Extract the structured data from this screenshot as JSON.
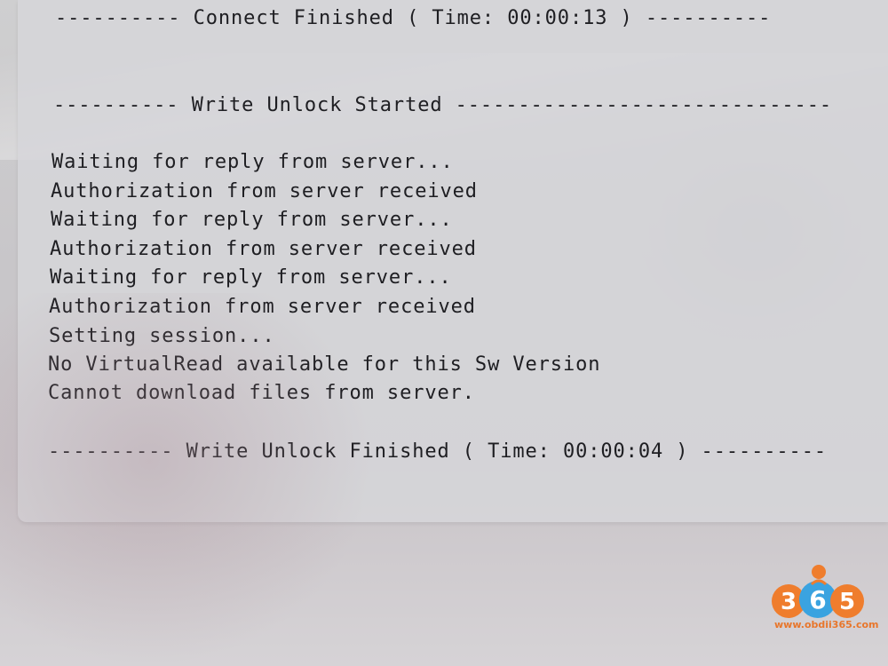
{
  "console": {
    "connect_finished": "---------- Connect Finished ( Time: 00:00:13 ) ----------",
    "write_unlock_started": "---------- Write Unlock Started ------------------------------",
    "lines": [
      "Waiting for reply from server...",
      "Authorization from server received",
      "Waiting for reply from server...",
      "Authorization from server received",
      "Waiting for reply from server...",
      "Authorization from server received",
      "Setting session...",
      "No VirtualRead available for this Sw Version",
      "Cannot download files from server."
    ],
    "write_unlock_finished": "---------- Write Unlock Finished ( Time: 00:00:04 ) ----------"
  },
  "watermark": {
    "logo_text": "365",
    "url": "www.obdii365.com",
    "color": "#e8762b"
  }
}
